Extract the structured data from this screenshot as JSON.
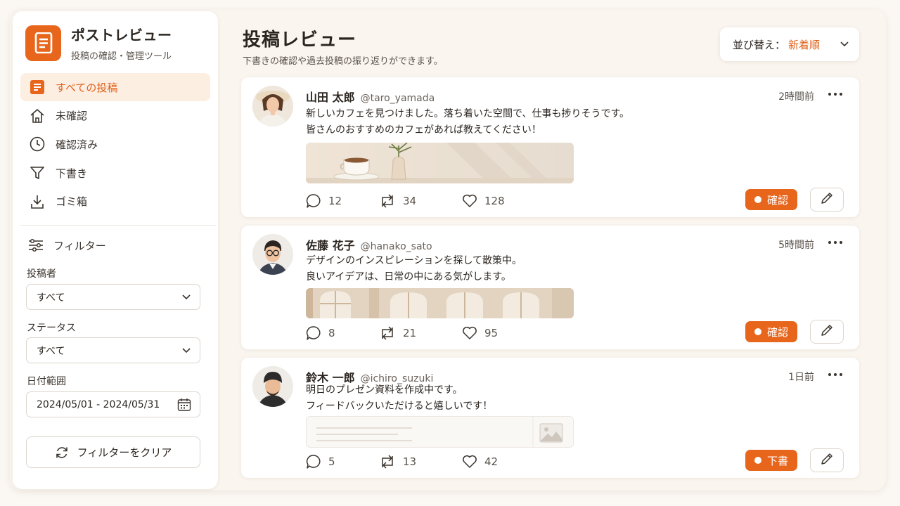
{
  "app": {
    "title": "ポストレビュー",
    "subtitle": "投稿の確認・管理ツール"
  },
  "nav": {
    "items": [
      {
        "label": "すべての投稿",
        "icon": "document-icon",
        "active": true
      },
      {
        "label": "未確認",
        "icon": "home-icon"
      },
      {
        "label": "確認済み",
        "icon": "clock-icon"
      },
      {
        "label": "下書き",
        "icon": "funnel-icon"
      },
      {
        "label": "ゴミ箱",
        "icon": "download-icon"
      }
    ]
  },
  "filters": {
    "heading": "フィルター",
    "author_label": "投稿者",
    "author_value": "すべて",
    "status_label": "ステータス",
    "status_value": "すべて",
    "date_label": "日付範囲",
    "date_value": "2024/05/01 - 2024/05/31",
    "clear_label": "フィルターをクリア"
  },
  "main": {
    "title": "投稿レビュー",
    "subtitle": "下書きの確認や過去投稿の振り返りができます。",
    "sort_label": "並び替え：",
    "sort_value": "新着順"
  },
  "posts": [
    {
      "name": "山田 太郎",
      "handle": "@taro_yamada",
      "time": "2時間前",
      "lines": [
        "新しいカフェを見つけました。落ち着いた空間で、仕事も捗りそうです。",
        "皆さんのおすすめのカフェがあれば教えてください！"
      ],
      "comments": "12",
      "reposts": "34",
      "likes": "128",
      "status": "確認"
    },
    {
      "name": "佐藤 花子",
      "handle": "@hanako_sato",
      "time": "5時間前",
      "lines": [
        "デザインのインスピレーションを探して散策中。",
        "良いアイデアは、日常の中にある気がします。"
      ],
      "comments": "8",
      "reposts": "21",
      "likes": "95",
      "status": "確認"
    },
    {
      "name": "鈴木 一郎",
      "handle": "@ichiro_suzuki",
      "time": "1日前",
      "lines": [
        "明日のプレゼン資料を作成中です。",
        "フィードバックいただけると嬉しいです！"
      ],
      "comments": "5",
      "reposts": "13",
      "likes": "42",
      "status": "下書"
    }
  ],
  "colors": {
    "accent": "#e8661c",
    "background": "#fbf7f2",
    "active_bg": "#fdeee2"
  }
}
